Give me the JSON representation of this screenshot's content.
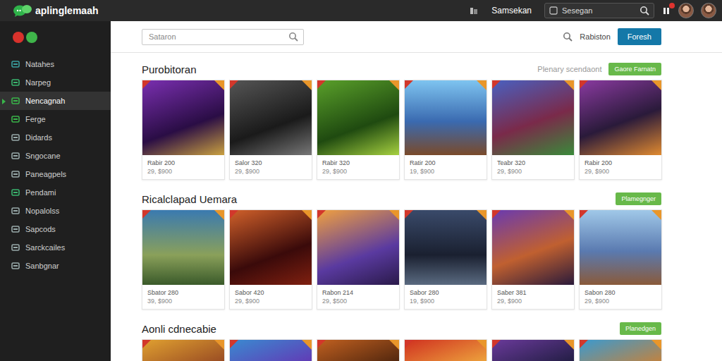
{
  "app": {
    "title": "aplinglemaah"
  },
  "topbar": {
    "link": "Samsekan",
    "search": {
      "placeholder": "Sesegan"
    }
  },
  "sidebar": {
    "items": [
      {
        "label": "Natahes",
        "selected": false
      },
      {
        "label": "Narpeg",
        "selected": false
      },
      {
        "label": "Nencagnah",
        "selected": true
      },
      {
        "label": "Ferge",
        "selected": false
      },
      {
        "label": "Didards",
        "selected": false
      },
      {
        "label": "Sngocane",
        "selected": false
      },
      {
        "label": "Paneagpels",
        "selected": false
      },
      {
        "label": "Pendami",
        "selected": false
      },
      {
        "label": "Nopalolss",
        "selected": false
      },
      {
        "label": "Sapcods",
        "selected": false
      },
      {
        "label": "Sarckcailes",
        "selected": false
      },
      {
        "label": "Sanbgnar",
        "selected": false
      }
    ]
  },
  "toolbar": {
    "search": {
      "placeholder": "Sataron"
    },
    "link": "Rabiston",
    "button": "Foresh"
  },
  "sections": [
    {
      "title": "Purobitoran",
      "subtitle": "Plenary scendaont",
      "button": "Gaore Farnatn",
      "games": [
        {
          "name": "Rabir 200",
          "price": "29, $900"
        },
        {
          "name": "Salor 320",
          "price": "29, $900"
        },
        {
          "name": "Rabir 320",
          "price": "29, $900"
        },
        {
          "name": "Ratir 200",
          "price": "19, $900"
        },
        {
          "name": "Teabr 320",
          "price": "29, $900"
        },
        {
          "name": "Rabir 200",
          "price": "29, $900"
        }
      ]
    },
    {
      "title": "Ricalclapad Uemara",
      "subtitle": "",
      "button": "Plamegnger",
      "games": [
        {
          "name": "Sbator 280",
          "price": "39, $900"
        },
        {
          "name": "Sabor 420",
          "price": "29, $900"
        },
        {
          "name": "Rabon 214",
          "price": "29, $500"
        },
        {
          "name": "Sabor 280",
          "price": "19, $900"
        },
        {
          "name": "Saber 381",
          "price": "29, $900"
        },
        {
          "name": "Sabon 280",
          "price": "29, $900"
        }
      ]
    },
    {
      "title": "Aonli cdnecabie",
      "subtitle": "",
      "button": "Planedgen",
      "games": [
        {},
        {},
        {},
        {},
        {},
        {}
      ]
    }
  ]
}
